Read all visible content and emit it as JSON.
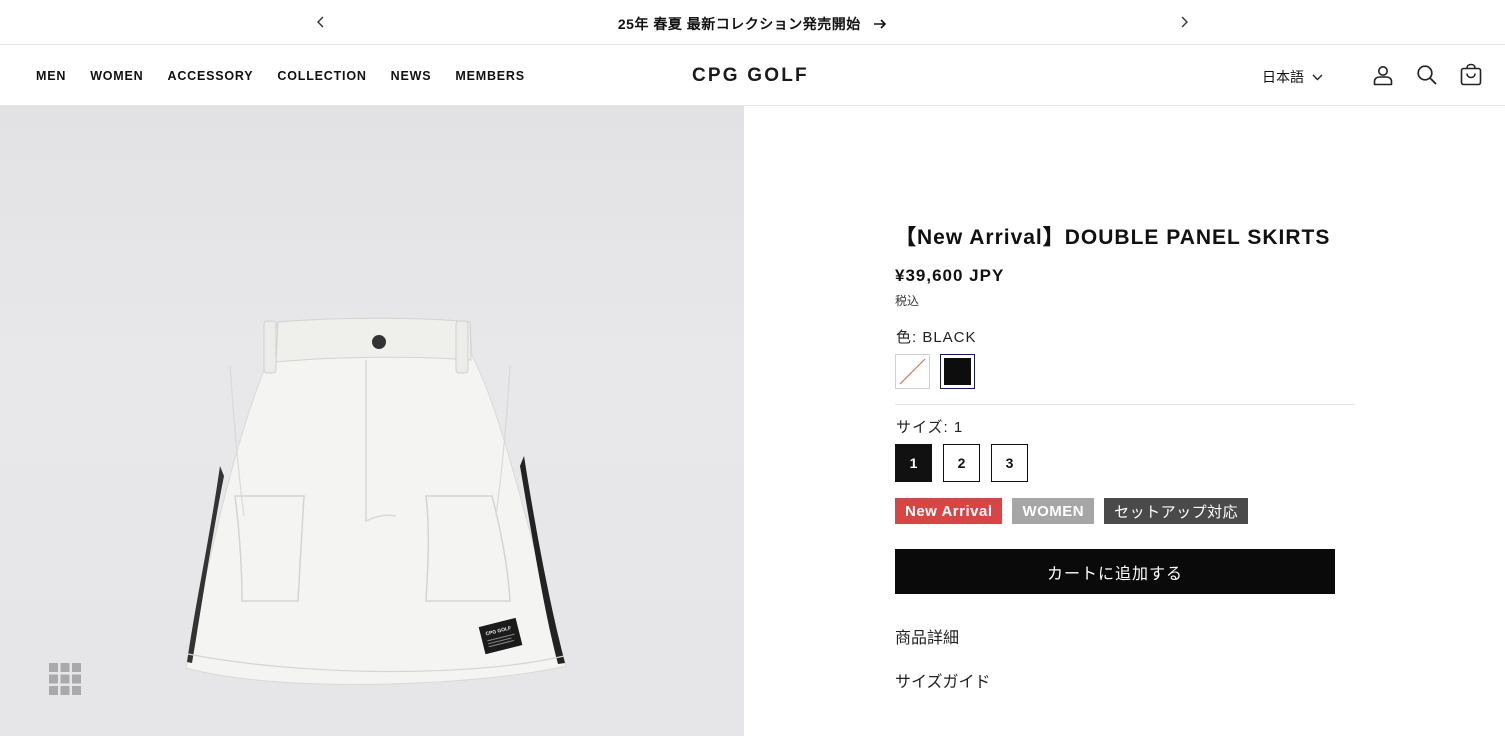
{
  "announcement": {
    "text": "25年 春夏 最新コレクション発売開始",
    "prev_icon": "chevron-left-icon",
    "next_icon": "chevron-right-icon",
    "go_icon": "arrow-right-icon"
  },
  "header": {
    "nav": [
      "MEN",
      "WOMEN",
      "ACCESSORY",
      "COLLECTION",
      "NEWS",
      "MEMBERS"
    ],
    "logo": "CPG GOLF",
    "language": "日本語",
    "icons": [
      "account-icon",
      "search-icon",
      "cart-icon"
    ]
  },
  "product": {
    "title": "【New Arrival】DOUBLE PANEL SKIRTS",
    "price": "¥39,600 JPY",
    "tax_note": "税込",
    "color_label": "色: BLACK",
    "colors": [
      {
        "name": "white",
        "hex": "#ffffff",
        "available": false
      },
      {
        "name": "black",
        "hex": "#0d0d0d",
        "available": true,
        "selected": true
      }
    ],
    "size_label": "サイズ: 1",
    "sizes": [
      "1",
      "2",
      "3"
    ],
    "selected_size": "1",
    "tags": [
      "New Arrival",
      "WOMEN",
      "セットアップ対応"
    ],
    "tag_colors": {
      "new": "#d94545",
      "women": "#a6a6a6",
      "setup": "#4a4a4a"
    },
    "add_to_cart": "カートに追加する",
    "details_link": "商品詳細",
    "size_guide_link": "サイズガイド",
    "image_label": "CPG GOLF"
  }
}
